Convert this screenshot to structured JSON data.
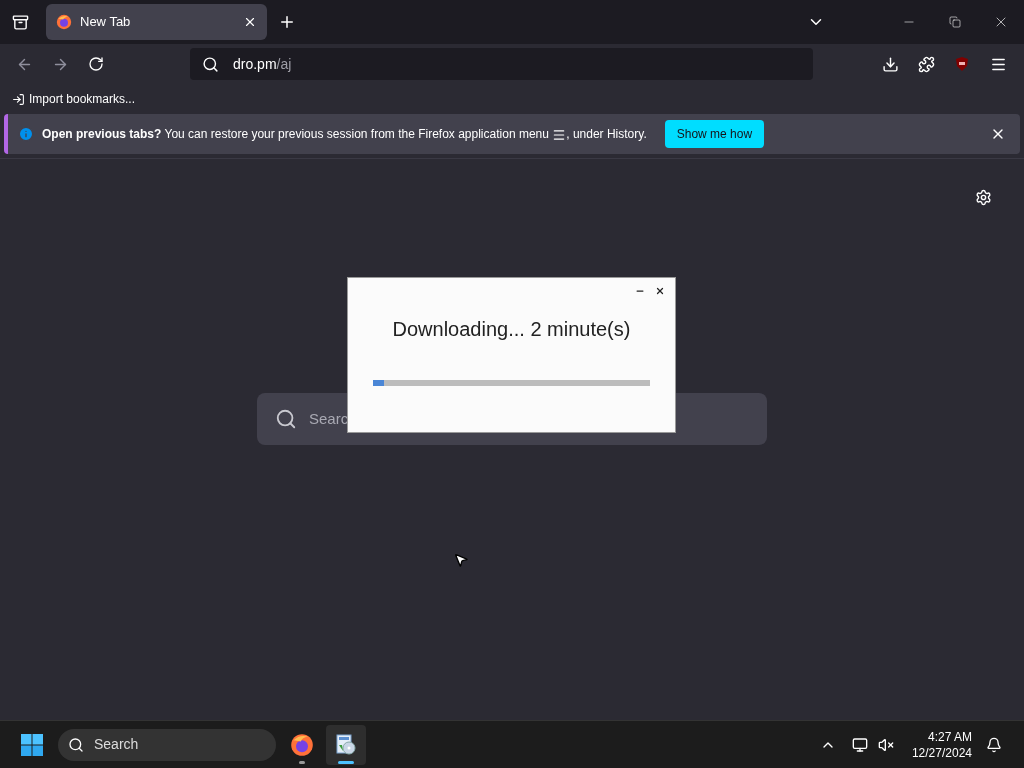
{
  "tabs": [
    {
      "label": "New Tab",
      "selected": true
    }
  ],
  "address": {
    "host": "dro.pm",
    "path": "/aj"
  },
  "bookmarks": [
    {
      "label": "Import bookmarks..."
    }
  ],
  "notification": {
    "title": "Open previous tabs?",
    "text_before": "You can restore your previous session from the Firefox application menu",
    "text_after": ", under History.",
    "button": "Show me how"
  },
  "newtab_search": {
    "placeholder": "Searc"
  },
  "dialog": {
    "message": "Downloading... 2 minute(s)",
    "level": 0.04
  },
  "taskbar": {
    "search_placeholder": "Search",
    "apps": [
      {
        "kind": "firefox",
        "active": false
      },
      {
        "kind": "installer",
        "active": true
      }
    ],
    "time": "4:27 AM",
    "date": "12/27/2024"
  }
}
